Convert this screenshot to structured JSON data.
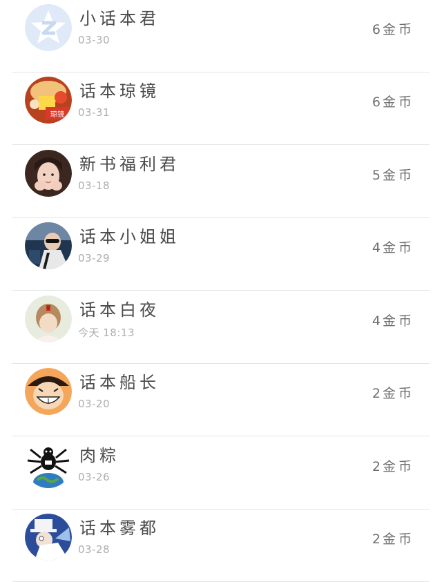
{
  "coin_unit": "金币",
  "items": [
    {
      "name": "小话本君",
      "date": "03-30",
      "amount": "6",
      "avatar": "qzone-star-icon"
    },
    {
      "name": "话本琼镜",
      "date": "03-31",
      "amount": "6",
      "avatar": "illustrated-avatar",
      "avatar_text": "琼镜"
    },
    {
      "name": "新书福利君",
      "date": "03-18",
      "amount": "5",
      "avatar": "girl-portrait-avatar"
    },
    {
      "name": "话本小姐姐",
      "date": "03-29",
      "amount": "4",
      "avatar": "sunglasses-portrait-avatar"
    },
    {
      "name": "话本白夜",
      "date": "今天  18:13",
      "amount": "4",
      "avatar": "girl-red-bow-avatar"
    },
    {
      "name": "话本船长",
      "date": "03-20",
      "amount": "2",
      "avatar": "anime-straw-hat-avatar"
    },
    {
      "name": "肉粽",
      "date": "03-26",
      "amount": "2",
      "avatar": "spider-earth-avatar"
    },
    {
      "name": "话本雾都",
      "date": "03-28",
      "amount": "2",
      "avatar": "anime-top-hat-avatar"
    }
  ]
}
